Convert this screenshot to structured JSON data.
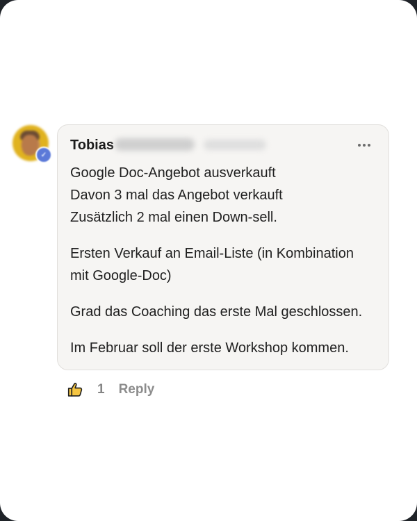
{
  "comment": {
    "author_first_name": "Tobias",
    "paragraphs": [
      "Google Doc-Angebot ausverkauft\nDavon 3 mal das Angebot verkauft\nZusätzlich 2 mal einen Down-sell.",
      "Ersten Verkauf an Email-Liste (in Kombination\nmit Google-Doc)",
      "Grad das Coaching das erste Mal geschlossen.",
      "Im Februar soll der erste Workshop kommen."
    ],
    "like_count": "1",
    "reply_label": "Reply",
    "more_icon": "more-horizontal-icon",
    "like_icon": "thumbs-up-icon"
  },
  "colors": {
    "bubble_background": "#f6f5f3",
    "text": "#202020",
    "muted": "#858585",
    "badge": "#5b79d8",
    "like_icon": "#f5c542"
  }
}
